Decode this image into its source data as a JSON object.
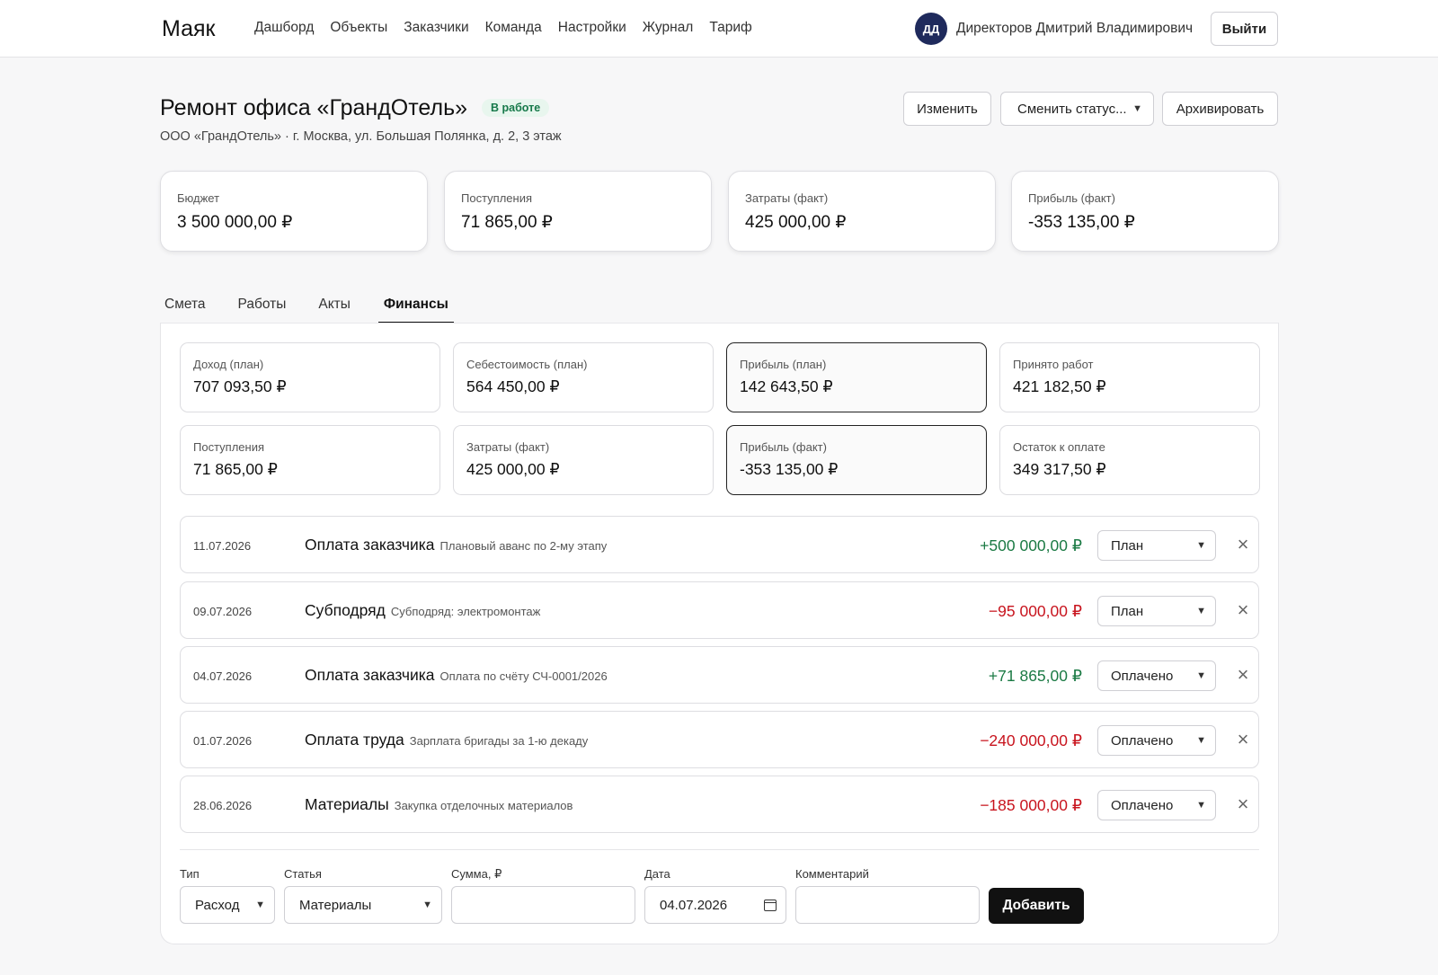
{
  "header": {
    "brand": "Маяк",
    "nav": [
      "Дашборд",
      "Объекты",
      "Заказчики",
      "Команда",
      "Настройки",
      "Журнал",
      "Тариф"
    ],
    "user_initials": "ДД",
    "user_name": "Директоров Дмитрий Владимирович",
    "logout_label": "Выйти"
  },
  "project": {
    "title": "Ремонт офиса «ГрандОтель»",
    "status": "В работе",
    "subtitle": "ООО «ГрандОтель» · г. Москва, ул. Большая Полянка, д. 2, 3 этаж",
    "edit_label": "Изменить",
    "status_select": "Сменить статус...",
    "archive_label": "Архивировать"
  },
  "kpis": [
    {
      "label": "Бюджет",
      "value": "3 500 000,00 ₽"
    },
    {
      "label": "Поступления",
      "value": "71 865,00 ₽"
    },
    {
      "label": "Затраты (факт)",
      "value": "425 000,00 ₽"
    },
    {
      "label": "Прибыль (факт)",
      "value": "-353 135,00 ₽"
    }
  ],
  "tabs": [
    "Смета",
    "Работы",
    "Акты",
    "Финансы"
  ],
  "active_tab": "Финансы",
  "finance_cards": [
    {
      "label": "Доход (план)",
      "value": "707 093,50 ₽"
    },
    {
      "label": "Себестоимость (план)",
      "value": "564 450,00 ₽"
    },
    {
      "label": "Прибыль (план)",
      "value": "142 643,50 ₽"
    },
    {
      "label": "Принято работ",
      "value": "421 182,50 ₽"
    },
    {
      "label": "Поступления",
      "value": "71 865,00 ₽"
    },
    {
      "label": "Затраты (факт)",
      "value": "425 000,00 ₽"
    },
    {
      "label": "Прибыль (факт)",
      "value": "-353 135,00 ₽"
    },
    {
      "label": "Остаток к оплате",
      "value": "349 317,50 ₽"
    }
  ],
  "transactions": [
    {
      "date": "11.07.2026",
      "title": "Оплата заказчика",
      "note": "Плановый аванс по 2-му этапу",
      "amount": "+500 000,00 ₽",
      "status": "План"
    },
    {
      "date": "09.07.2026",
      "title": "Субподряд",
      "note": "Субподряд: электромонтаж",
      "amount": "−95 000,00 ₽",
      "status": "План"
    },
    {
      "date": "04.07.2026",
      "title": "Оплата заказчика",
      "note": "Оплата по счёту СЧ-0001/2026",
      "amount": "+71 865,00 ₽",
      "status": "Оплачено"
    },
    {
      "date": "01.07.2026",
      "title": "Оплата труда",
      "note": "Зарплата бригады за 1-ю декаду",
      "amount": "−240 000,00 ₽",
      "status": "Оплачено"
    },
    {
      "date": "28.06.2026",
      "title": "Материалы",
      "note": "Закупка отделочных материалов",
      "amount": "−185 000,00 ₽",
      "status": "Оплачено"
    }
  ],
  "form": {
    "type_label": "Тип",
    "type_value": "Расход",
    "article_label": "Статья",
    "article_value": "Материалы",
    "sum_label": "Сумма, ₽",
    "sum_value": "",
    "date_label": "Дата",
    "date_value": "04.07.2026",
    "comment_label": "Комментарий",
    "comment_value": "",
    "add_label": "Добавить"
  },
  "colors": {
    "positive": "#1b7a44",
    "negative": "#c8141e",
    "accent": "#111111",
    "avatar": "#1f2a5c",
    "badge_text": "#17794a",
    "badge_bg": "#e8f6ee"
  }
}
